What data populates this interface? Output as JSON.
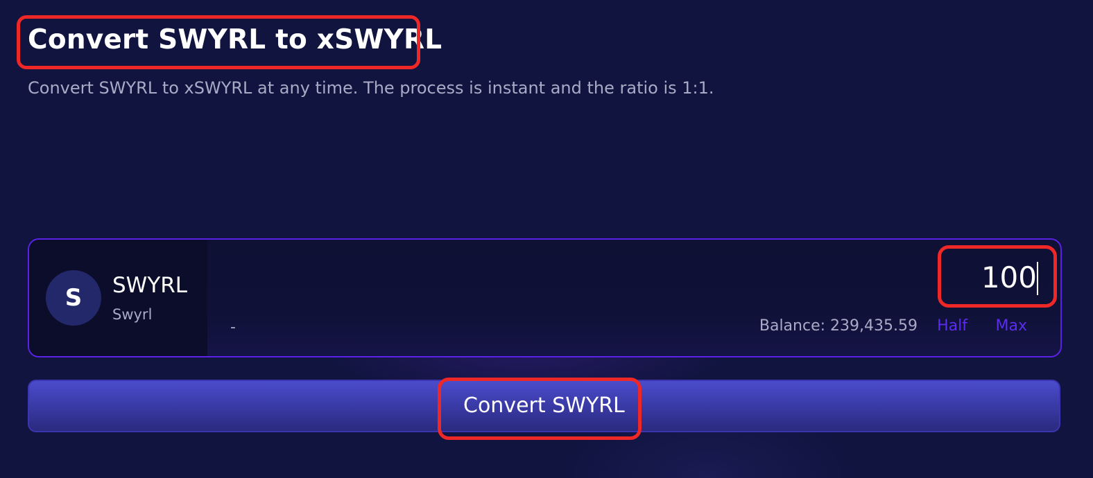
{
  "header": {
    "title": "Convert SWYRL to xSWYRL",
    "subtitle": "Convert SWYRL to xSWYRL at any time. The process is instant and the ratio is 1:1."
  },
  "token": {
    "avatar_letter": "S",
    "symbol": "SWYRL",
    "name": "Swyrl",
    "usd_value": "-"
  },
  "amount": {
    "value": "100",
    "balance_label": "Balance: 239,435.59",
    "half_label": "Half",
    "max_label": "Max"
  },
  "actions": {
    "convert_label": "Convert SWYRL"
  },
  "colors": {
    "background": "#11143f",
    "accent": "#5b2cf0",
    "highlight": "#ee2727",
    "button": "#3a3aa6"
  }
}
